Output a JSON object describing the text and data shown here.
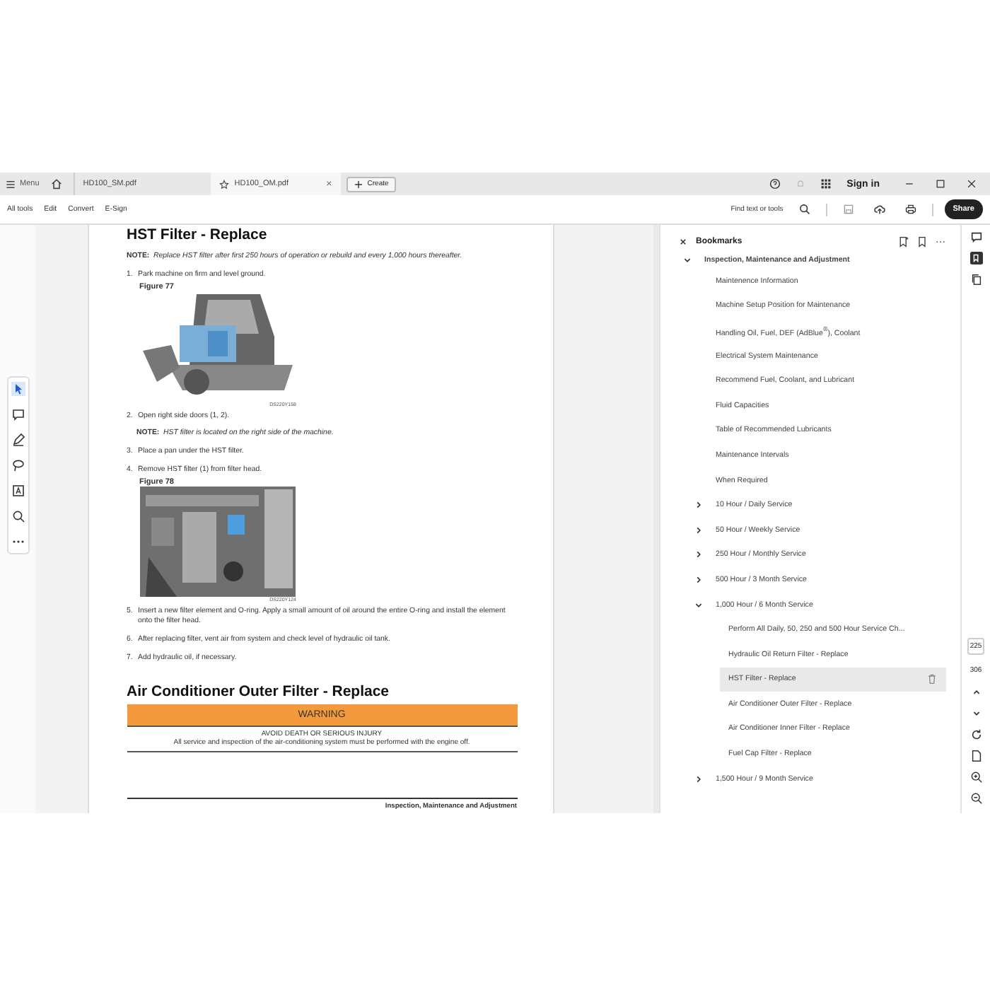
{
  "tabbar": {
    "menu": "Menu",
    "tabs": [
      {
        "label": "HD100_SM.pdf",
        "selected": false
      },
      {
        "label": "HD100_OM.pdf",
        "selected": true
      }
    ],
    "close": "×",
    "create": "Create",
    "sign_in": "Sign in"
  },
  "toolbar": {
    "items": [
      "All tools",
      "Edit",
      "Convert",
      "E-Sign"
    ],
    "search": "Find text or tools",
    "share": "Share"
  },
  "document": {
    "heading": "HST Filter - Replace",
    "blocks": [
      {
        "kind": "note",
        "label": "NOTE:",
        "text": "Replace HST filter after first 250 hours of operation or rebuild and every 1,000 hours thereafter."
      },
      {
        "kind": "step",
        "number": "1.",
        "text": "Park machine on firm and level ground."
      },
      {
        "kind": "figure",
        "title": "Figure 77",
        "caption": "DS220Y158"
      },
      {
        "kind": "step",
        "number": "2.",
        "text": "Open right side doors (1, 2)."
      },
      {
        "kind": "note",
        "label": "NOTE:",
        "text": "HST filter is located on the right side of the machine."
      },
      {
        "kind": "step",
        "number": "3.",
        "text": "Place a pan under the HST filter."
      },
      {
        "kind": "step",
        "number": "4.",
        "text": "Remove HST filter (1) from filter head."
      },
      {
        "kind": "figure",
        "title": "Figure 78",
        "caption": "DS220Y124"
      },
      {
        "kind": "step",
        "number": "5.",
        "text": "Insert a new filter element and O-ring. Apply a small amount of oil around the entire O-ring and install the element onto the filter head."
      },
      {
        "kind": "step",
        "number": "6.",
        "text": "After replacing filter, vent air from system and check level of hydraulic oil tank."
      },
      {
        "kind": "step",
        "number": "7.",
        "text": "Add hydraulic oil, if necessary."
      }
    ],
    "heading2": "Air Conditioner Outer Filter - Replace",
    "warning": {
      "title": "WARNING",
      "subtitle": "AVOID DEATH OR SERIOUS INJURY",
      "text": "All service and inspection of the air-conditioning system must be performed with the engine off."
    },
    "footer": "Inspection, Maintenance and Adjustment"
  },
  "bookmarks": {
    "title": "Bookmarks",
    "items": [
      {
        "label": "Inspection, Maintenance and Adjustment",
        "expanded": true,
        "selected": false,
        "children": [
          {
            "label": "Maintenence Information",
            "selected": false
          },
          {
            "label": "Machine Setup Position for Maintenance",
            "selected": false
          },
          {
            "label": "Handling Oil, Fuel, DEF (AdBlue$^{®}$), Coolant",
            "selected": false
          },
          {
            "label": "Electrical System Maintenance",
            "selected": false
          },
          {
            "label": "Recommend Fuel, Coolant, and Lubricant",
            "selected": false
          },
          {
            "label": "Fluid Capacities",
            "selected": false
          },
          {
            "label": "Table of Recommended Lubricants",
            "selected": false
          },
          {
            "label": "Maintenance Intervals",
            "selected": false
          },
          {
            "label": "When Required",
            "selected": false
          },
          {
            "label": "10 Hour / Daily Service",
            "expanded": false,
            "selected": false
          },
          {
            "label": "50 Hour / Weekly Service",
            "expanded": false,
            "selected": false
          },
          {
            "label": "250 Hour / Monthly Service",
            "expanded": false,
            "selected": false
          },
          {
            "label": "500 Hour / 3 Month Service",
            "expanded": false,
            "selected": false
          },
          {
            "label": "1,000 Hour / 6 Month Service",
            "expanded": true,
            "selected": false,
            "children": [
              {
                "label": "Perform All Daily, 50, 250 and 500 Hour Service Ch...",
                "selected": false
              },
              {
                "label": "Hydraulic Oil Return Filter - Replace",
                "selected": false
              },
              {
                "label": "HST Filter - Replace",
                "selected": true
              },
              {
                "label": "Air Conditioner Outer Filter - Replace",
                "selected": false
              },
              {
                "label": "Air Conditioner Inner Filter - Replace",
                "selected": false
              },
              {
                "label": "Fuel Cap Filter - Replace",
                "selected": false
              }
            ]
          },
          {
            "label": "1,500 Hour / 9 Month Service",
            "expanded": false,
            "selected": false
          }
        ]
      }
    ]
  },
  "page_nav": {
    "current": "225",
    "total": "306"
  }
}
